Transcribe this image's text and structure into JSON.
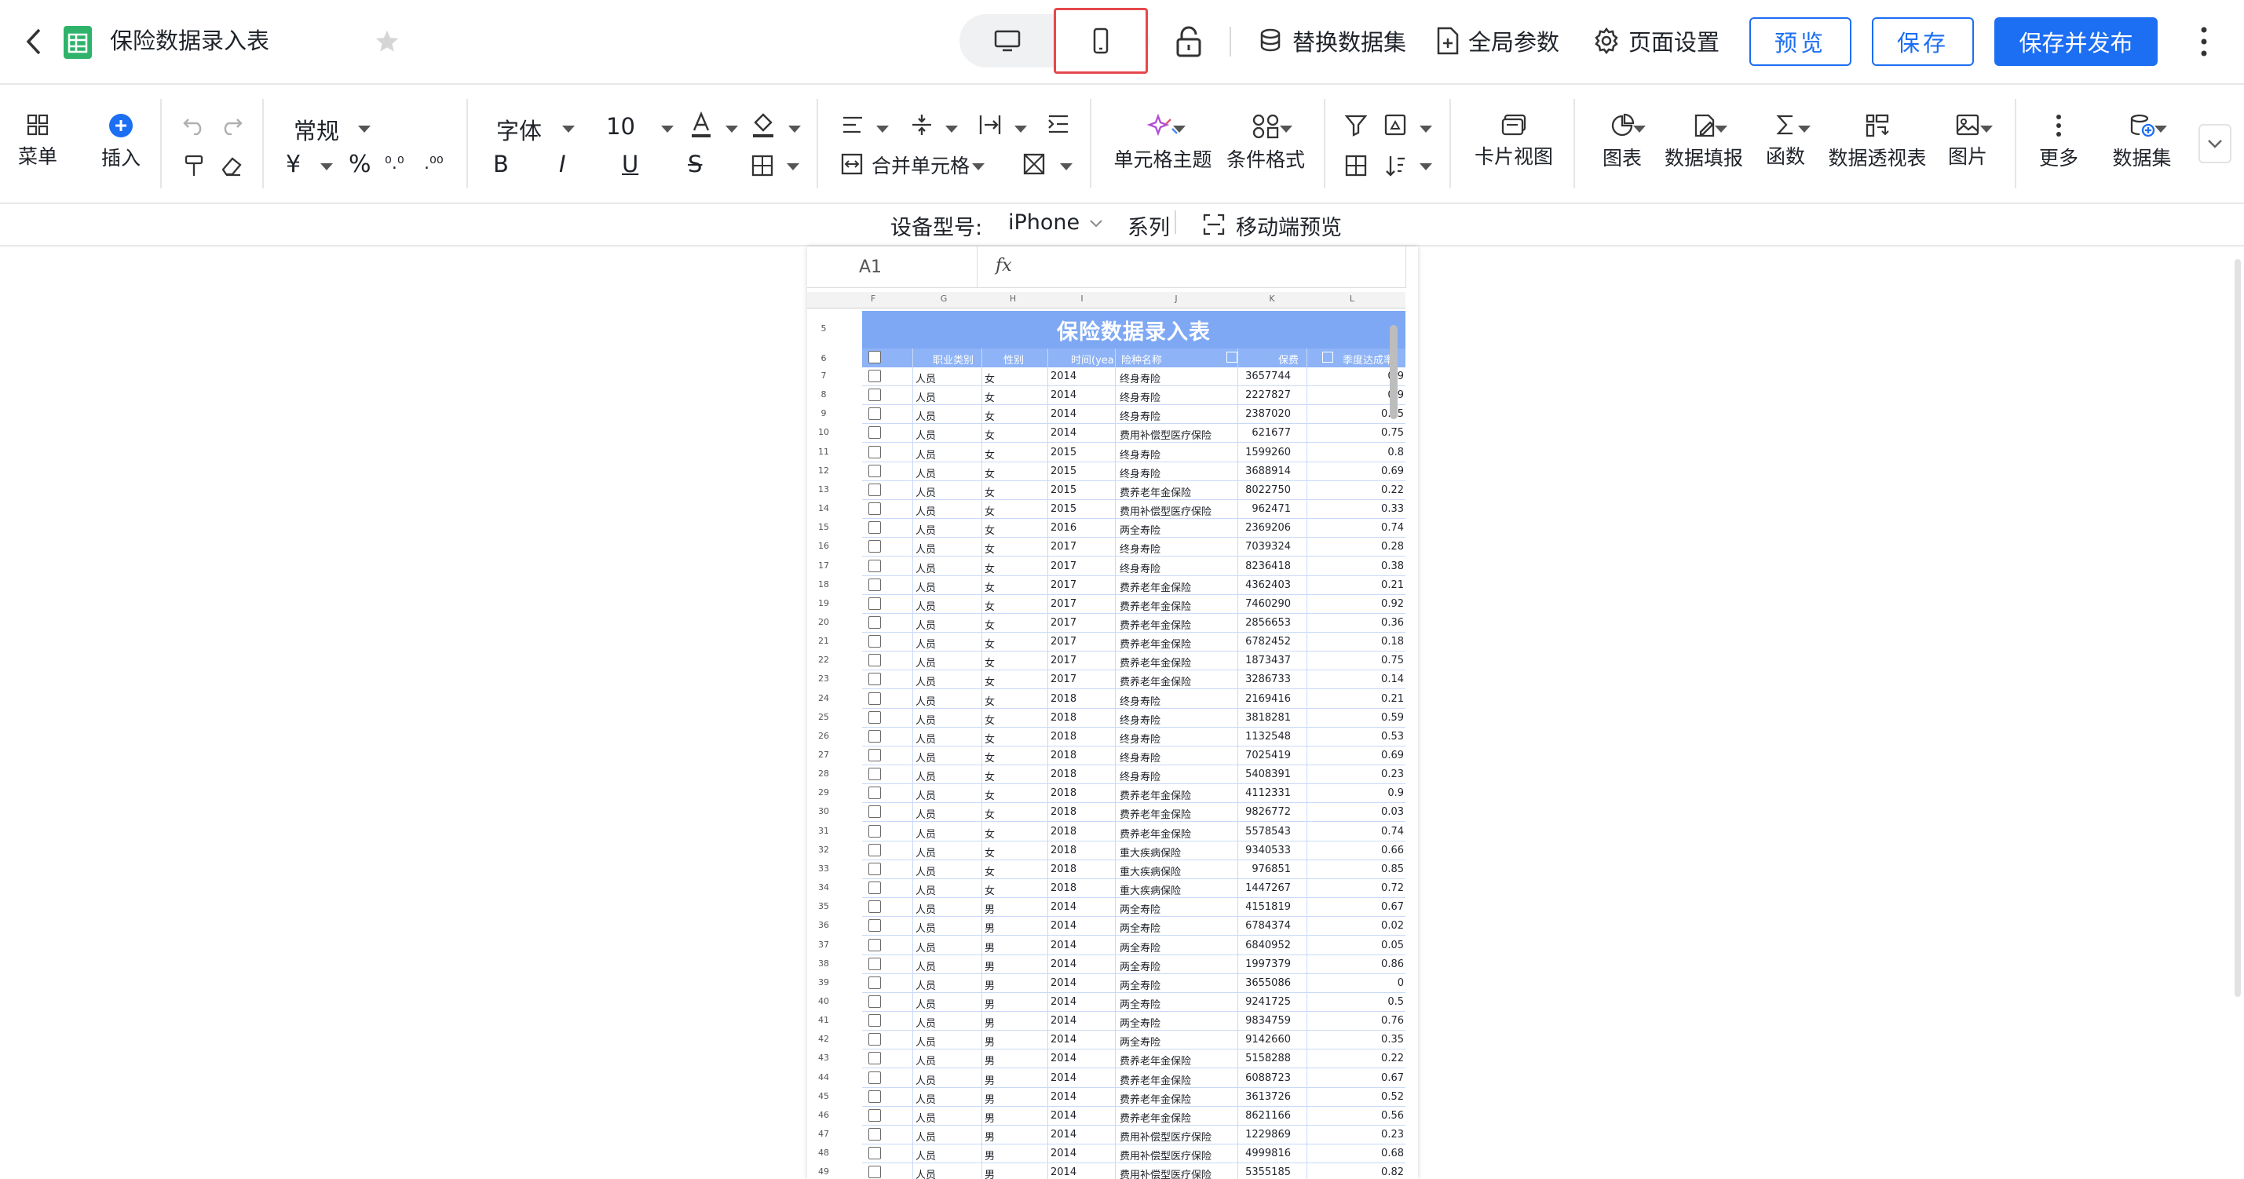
{
  "header": {
    "title": "保险数据录入表",
    "actions": {
      "replace_dataset": "替换数据集",
      "global_params": "全局参数",
      "page_settings": "页面设置",
      "preview": "预览",
      "save": "保存",
      "save_publish": "保存并发布"
    }
  },
  "toolbar": {
    "menu": "菜单",
    "insert": "插入",
    "number_format": "常规",
    "font": "字体",
    "font_size": "10",
    "merge_cells": "合并单元格",
    "cell_theme": "单元格主题",
    "conditional_format": "条件格式",
    "card_view": "卡片视图",
    "chart": "图表",
    "data_fill": "数据填报",
    "function": "函数",
    "pivot": "数据透视表",
    "image": "图片",
    "more": "更多",
    "dataset": "数据集"
  },
  "device_bar": {
    "model_label": "设备型号:",
    "model_value": "iPhone",
    "series": "系列",
    "mobile_preview": "移动端预览"
  },
  "sheet": {
    "cell_ref": "A1",
    "fx": "fx",
    "col_letters": [
      "F",
      "G",
      "H",
      "I",
      "J",
      "K",
      "L"
    ],
    "title_row": "5",
    "header_row": "6",
    "title": "保险数据录入表",
    "headers": [
      "职业类别",
      "性别",
      "时间(yea",
      "险种名称",
      "保费",
      "季度达成率"
    ],
    "rows": [
      [
        "7",
        "人员",
        "女",
        "2014",
        "终身寿险",
        "3657744",
        "0.9"
      ],
      [
        "8",
        "人员",
        "女",
        "2014",
        "终身寿险",
        "2227827",
        "0.9"
      ],
      [
        "9",
        "人员",
        "女",
        "2014",
        "终身寿险",
        "2387020",
        "0.35"
      ],
      [
        "10",
        "人员",
        "女",
        "2014",
        "费用补偿型医疗保险",
        "621677",
        "0.75"
      ],
      [
        "11",
        "人员",
        "女",
        "2015",
        "终身寿险",
        "1599260",
        "0.8"
      ],
      [
        "12",
        "人员",
        "女",
        "2015",
        "终身寿险",
        "3688914",
        "0.69"
      ],
      [
        "13",
        "人员",
        "女",
        "2015",
        "费养老年金保险",
        "8022750",
        "0.22"
      ],
      [
        "14",
        "人员",
        "女",
        "2015",
        "费用补偿型医疗保险",
        "962471",
        "0.33"
      ],
      [
        "15",
        "人员",
        "女",
        "2016",
        "两全寿险",
        "2369206",
        "0.74"
      ],
      [
        "16",
        "人员",
        "女",
        "2017",
        "终身寿险",
        "7039324",
        "0.28"
      ],
      [
        "17",
        "人员",
        "女",
        "2017",
        "终身寿险",
        "8236418",
        "0.38"
      ],
      [
        "18",
        "人员",
        "女",
        "2017",
        "费养老年金保险",
        "4362403",
        "0.21"
      ],
      [
        "19",
        "人员",
        "女",
        "2017",
        "费养老年金保险",
        "7460290",
        "0.92"
      ],
      [
        "20",
        "人员",
        "女",
        "2017",
        "费养老年金保险",
        "2856653",
        "0.36"
      ],
      [
        "21",
        "人员",
        "女",
        "2017",
        "费养老年金保险",
        "6782452",
        "0.18"
      ],
      [
        "22",
        "人员",
        "女",
        "2017",
        "费养老年金保险",
        "1873437",
        "0.75"
      ],
      [
        "23",
        "人员",
        "女",
        "2017",
        "费养老年金保险",
        "3286733",
        "0.14"
      ],
      [
        "24",
        "人员",
        "女",
        "2018",
        "终身寿险",
        "2169416",
        "0.21"
      ],
      [
        "25",
        "人员",
        "女",
        "2018",
        "终身寿险",
        "3818281",
        "0.59"
      ],
      [
        "26",
        "人员",
        "女",
        "2018",
        "终身寿险",
        "1132548",
        "0.53"
      ],
      [
        "27",
        "人员",
        "女",
        "2018",
        "终身寿险",
        "7025419",
        "0.69"
      ],
      [
        "28",
        "人员",
        "女",
        "2018",
        "终身寿险",
        "5408391",
        "0.23"
      ],
      [
        "29",
        "人员",
        "女",
        "2018",
        "费养老年金保险",
        "4112331",
        "0.9"
      ],
      [
        "30",
        "人员",
        "女",
        "2018",
        "费养老年金保险",
        "9826772",
        "0.03"
      ],
      [
        "31",
        "人员",
        "女",
        "2018",
        "费养老年金保险",
        "5578543",
        "0.74"
      ],
      [
        "32",
        "人员",
        "女",
        "2018",
        "重大疾病保险",
        "9340533",
        "0.66"
      ],
      [
        "33",
        "人员",
        "女",
        "2018",
        "重大疾病保险",
        "976851",
        "0.85"
      ],
      [
        "34",
        "人员",
        "女",
        "2018",
        "重大疾病保险",
        "1447267",
        "0.72"
      ],
      [
        "35",
        "人员",
        "男",
        "2014",
        "两全寿险",
        "4151819",
        "0.67"
      ],
      [
        "36",
        "人员",
        "男",
        "2014",
        "两全寿险",
        "6784374",
        "0.02"
      ],
      [
        "37",
        "人员",
        "男",
        "2014",
        "两全寿险",
        "6840952",
        "0.05"
      ],
      [
        "38",
        "人员",
        "男",
        "2014",
        "两全寿险",
        "1997379",
        "0.86"
      ],
      [
        "39",
        "人员",
        "男",
        "2014",
        "两全寿险",
        "3655086",
        "0"
      ],
      [
        "40",
        "人员",
        "男",
        "2014",
        "两全寿险",
        "9241725",
        "0.5"
      ],
      [
        "41",
        "人员",
        "男",
        "2014",
        "两全寿险",
        "9834759",
        "0.76"
      ],
      [
        "42",
        "人员",
        "男",
        "2014",
        "两全寿险",
        "9142660",
        "0.35"
      ],
      [
        "43",
        "人员",
        "男",
        "2014",
        "费养老年金保险",
        "5158288",
        "0.22"
      ],
      [
        "44",
        "人员",
        "男",
        "2014",
        "费养老年金保险",
        "6088723",
        "0.67"
      ],
      [
        "45",
        "人员",
        "男",
        "2014",
        "费养老年金保险",
        "3613726",
        "0.52"
      ],
      [
        "46",
        "人员",
        "男",
        "2014",
        "费养老年金保险",
        "8621166",
        "0.56"
      ],
      [
        "47",
        "人员",
        "男",
        "2014",
        "费用补偿型医疗保险",
        "1229869",
        "0.23"
      ],
      [
        "48",
        "人员",
        "男",
        "2014",
        "费用补偿型医疗保险",
        "4999816",
        "0.68"
      ],
      [
        "49",
        "人员",
        "男",
        "2014",
        "费用补偿型医疗保险",
        "5355185",
        "0.82"
      ]
    ]
  }
}
